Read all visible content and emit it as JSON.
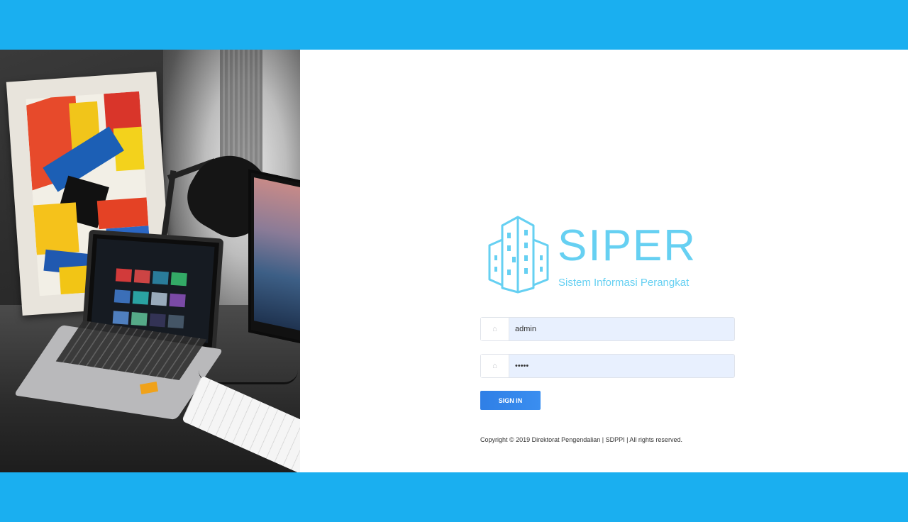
{
  "brand": {
    "name": "SIPER",
    "tagline": "Sistem Informasi Perangkat",
    "color": "#66d0f2"
  },
  "form": {
    "username": {
      "icon": "user-icon",
      "icon_glyph": "⌂",
      "value": "admin"
    },
    "password": {
      "icon": "lock-icon",
      "icon_glyph": "⌂",
      "value": "•••••"
    },
    "submit_label": "SIGN IN"
  },
  "footer": {
    "copyright": "Copyright © 2019 Direktorat Pengendalian | SDPPI | All rights reserved."
  },
  "colors": {
    "band": "#1aaff0",
    "accent": "#66d0f2",
    "button": "#2f7fe6",
    "input_bg": "#e8f0fe"
  }
}
